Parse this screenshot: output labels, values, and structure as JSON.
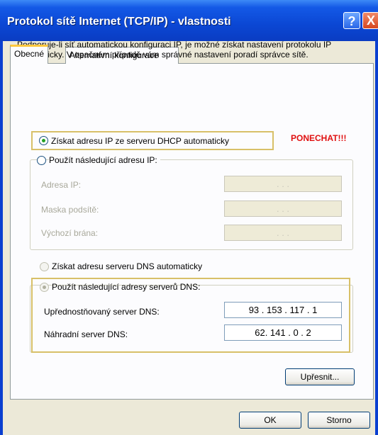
{
  "window": {
    "title": "Protokol sítě Internet (TCP/IP) - vlastnosti",
    "help_glyph": "?",
    "close_glyph": "X"
  },
  "tabs": [
    {
      "label": "Obecné",
      "active": true
    },
    {
      "label": "Alternativní konfigurace",
      "active": false
    }
  ],
  "intro_text": "Podporuje-li síť automatickou konfiguraci IP, je možné získat nastavení protokolu IP automaticky. V opačném případě vám správné nastavení poradí správce sítě.",
  "ip": {
    "auto_label": "Získat adresu IP ze serveru DHCP automaticky",
    "auto_selected": true,
    "manual_label": "Použít následující adresu IP:",
    "fields": [
      {
        "label": "Adresa IP:",
        "value": "   .   .   ."
      },
      {
        "label": "Maska podsítě:",
        "value": "   .   .   ."
      },
      {
        "label": "Výchozí brána:",
        "value": "   .   .   ."
      }
    ]
  },
  "annotation": "PONECHAT!!!",
  "dns": {
    "auto_label": "Získat adresu serveru DNS automaticky",
    "manual_label": "Použít následující adresy serverů DNS:",
    "manual_selected": true,
    "preferred_label": "Upřednostňovaný server DNS:",
    "preferred_value": "93 . 153 . 117 . 1",
    "alternate_label": "Náhradní server DNS:",
    "alternate_value": "62.  141  . 0  .  2"
  },
  "buttons": {
    "advanced": "Upřesnit...",
    "ok": "OK",
    "cancel": "Storno"
  },
  "colors": {
    "titlebar": "#0b47d4",
    "dialog_bg": "#ece9d8",
    "highlight_box": "#d8c068",
    "annotation": "#e01010"
  }
}
